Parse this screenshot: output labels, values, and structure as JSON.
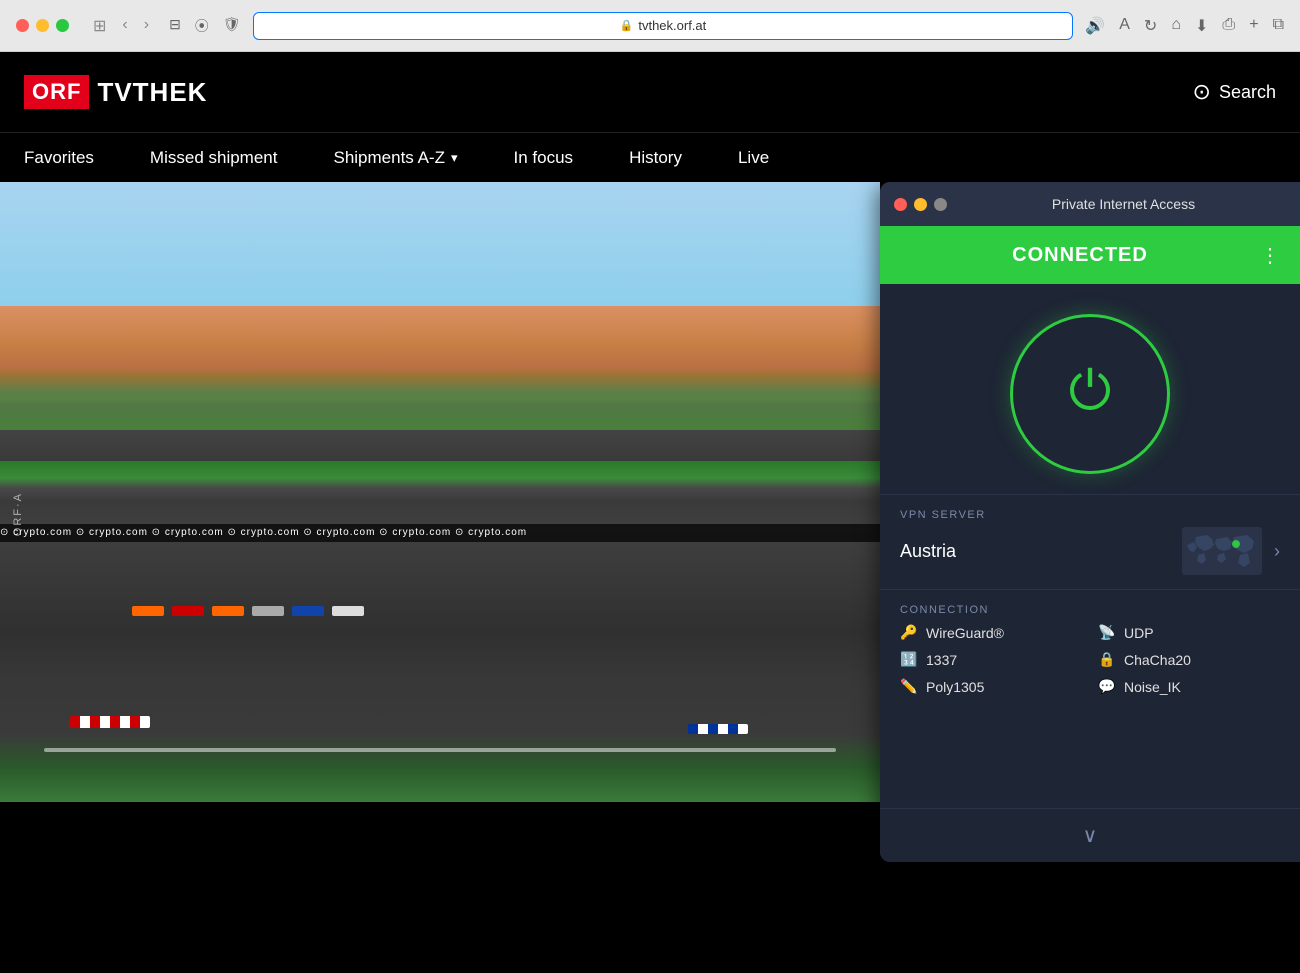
{
  "browser": {
    "url": "tvthek.orf.at",
    "url_lock": "🔒"
  },
  "orf": {
    "logo_orf": "ORF",
    "logo_tvthek": "TVTHEK",
    "search_label": "Search",
    "nav": {
      "favorites": "Favorites",
      "missed_shipment": "Missed shipment",
      "shipments_az": "Shipments A-Z",
      "in_focus": "In focus",
      "history": "History",
      "live": "Live"
    },
    "watermark": "ORF·A",
    "crypto_banner": "⊙ crypto.com   ⊙ crypto.com   ⊙ crypto.com   ⊙ crypto.com   ⊙ crypto.com   ⊙ crypto.com   ⊙ crypto.com"
  },
  "pia": {
    "title": "Private Internet Access",
    "connected_label": "CONNECTED",
    "menu_dots": "⋮",
    "vpn_server_label": "VPN SERVER",
    "server_name": "Austria",
    "connection_label": "CONNECTION",
    "conn_items": [
      {
        "icon": "🔑",
        "value": "WireGuard®"
      },
      {
        "icon": "📡",
        "value": "UDP"
      },
      {
        "icon": "🔢",
        "value": "1337"
      },
      {
        "icon": "🔒",
        "value": "ChaCha20"
      },
      {
        "icon": "✏️",
        "value": "Poly1305"
      },
      {
        "icon": "💬",
        "value": "Noise_IK"
      }
    ],
    "down_arrow": "∨"
  }
}
